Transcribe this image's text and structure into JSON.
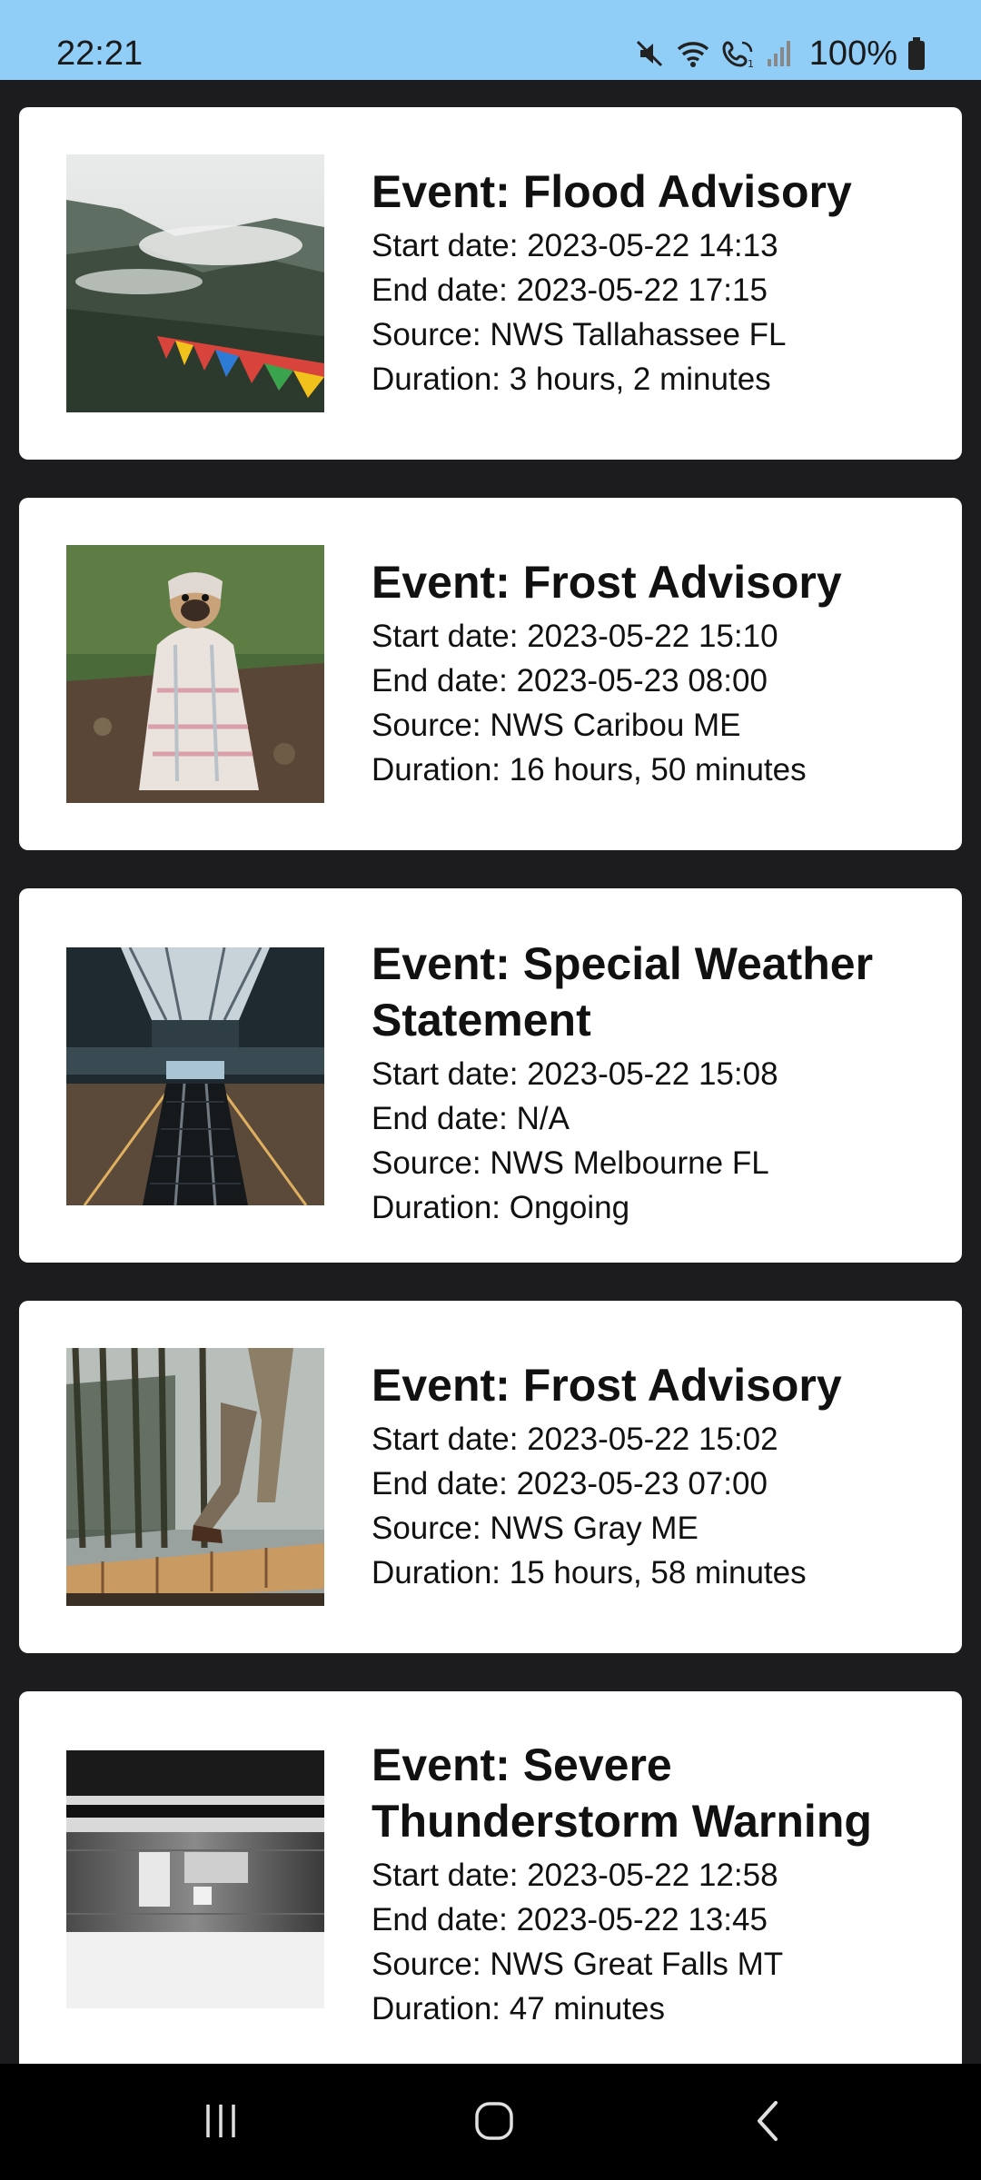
{
  "status_bar": {
    "time": "22:21",
    "battery": "100%",
    "icons": [
      "mute-icon",
      "wifi-icon",
      "wifi-call-icon",
      "signal-icon",
      "battery-icon"
    ]
  },
  "events": [
    {
      "title": "Event: Flood Advisory",
      "start": "Start date: 2023-05-22 14:13",
      "end": "End date: 2023-05-22 17:15",
      "source": "Source: NWS Tallahassee FL",
      "duration": "Duration: 3 hours, 2 minutes"
    },
    {
      "title": "Event: Frost Advisory",
      "start": "Start date: 2023-05-22 15:10",
      "end": "End date: 2023-05-23 08:00",
      "source": "Source: NWS Caribou ME",
      "duration": "Duration: 16 hours, 50 minutes"
    },
    {
      "title": "Event: Special Weather Statement",
      "start": "Start date: 2023-05-22 15:08",
      "end": "End date: N/A",
      "source": "Source: NWS Melbourne FL",
      "duration": "Duration: Ongoing"
    },
    {
      "title": "Event: Frost Advisory",
      "start": "Start date: 2023-05-22 15:02",
      "end": "End date: 2023-05-23 07:00",
      "source": "Source: NWS Gray ME",
      "duration": "Duration: 15 hours, 58 minutes"
    },
    {
      "title": "Event: Severe Thunderstorm Warning",
      "start": "Start date: 2023-05-22 12:58",
      "end": "End date: 2023-05-22 13:45",
      "source": "Source: NWS Great Falls MT",
      "duration": "Duration: 47 minutes"
    }
  ],
  "nav_bar": {
    "icons": [
      "recents-icon",
      "home-icon",
      "back-icon"
    ]
  },
  "colors": {
    "status_bar": "#90cdf7",
    "background": "#1c1c1e",
    "card": "#ffffff",
    "text": "#111111",
    "nav_bar": "#000000"
  }
}
